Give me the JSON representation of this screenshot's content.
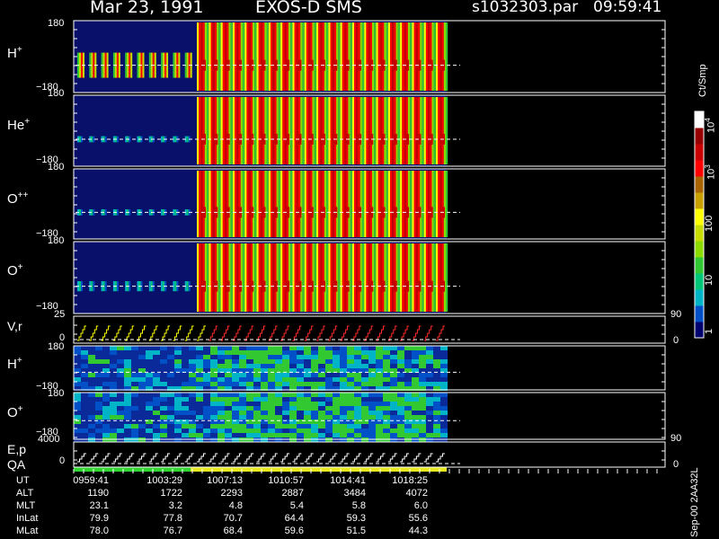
{
  "header": {
    "date": "Mar 23, 1991",
    "instrument": "EXOS-D SMS",
    "file": "s1032303.par",
    "time": "09:59:41"
  },
  "colorbar": {
    "unit_label": "Ct/Smp",
    "ticks": [
      "10",
      "100",
      "10",
      "10",
      "1"
    ],
    "tick_exponents": [
      "4",
      "",
      "3",
      "",
      ""
    ],
    "stops": [
      "#00006e",
      "#0050c8",
      "#00b4c8",
      "#00c878",
      "#32c832",
      "#8cdc00",
      "#c8dc00",
      "#ffff00",
      "#c8a000",
      "#aa6400",
      "#ff0000",
      "#c80000",
      "#960000",
      "#ffffff"
    ]
  },
  "footer": {
    "version": "Sep-00 2AA32L",
    "rows": [
      {
        "label": "UT",
        "values": [
          "0959:41",
          "1003:29",
          "1007:13",
          "1010:57",
          "1014:41",
          "1018:25"
        ]
      },
      {
        "label": "ALT",
        "values": [
          "1190",
          "1722",
          "2293",
          "2887",
          "3484",
          "4072"
        ]
      },
      {
        "label": "MLT",
        "values": [
          "23.1",
          "3.2",
          "4.8",
          "5.4",
          "5.8",
          "6.0"
        ]
      },
      {
        "label": "InLat",
        "values": [
          "79.9",
          "77.8",
          "70.7",
          "64.4",
          "59.3",
          "55.6"
        ]
      },
      {
        "label": "MLat",
        "values": [
          "78.0",
          "76.7",
          "68.4",
          "59.6",
          "51.5",
          "44.3"
        ]
      }
    ]
  },
  "chart_data": [
    {
      "type": "heatmap",
      "label": "H",
      "label_sup": "+",
      "yticks": [
        "180",
        "−180"
      ],
      "data_extent_ut": [
        "0959:41",
        "1018:25"
      ],
      "note_first_strong_ut": "1007:13"
    },
    {
      "type": "heatmap",
      "label": "He",
      "label_sup": "+",
      "yticks": [
        "180",
        "−180"
      ]
    },
    {
      "type": "heatmap",
      "label": "O",
      "label_sup": "++",
      "yticks": [
        "180",
        "−180"
      ]
    },
    {
      "type": "heatmap",
      "label": "O",
      "label_sup": "+",
      "yticks": [
        "180",
        "−180"
      ]
    },
    {
      "type": "line",
      "label": "V,r",
      "yticks": [
        "25",
        "0"
      ],
      "right_ticks": [
        "90",
        "0"
      ]
    },
    {
      "type": "heatmap",
      "label": "H",
      "label_sup": "+",
      "yticks": [
        "180",
        "−180"
      ]
    },
    {
      "type": "heatmap",
      "label": "O",
      "label_sup": "+",
      "yticks": [
        "180",
        "−180"
      ]
    },
    {
      "type": "line",
      "label": "E,p",
      "label2": "QA",
      "yticks": [
        "4000",
        "0"
      ],
      "right_ticks": [
        "90",
        "0"
      ]
    }
  ]
}
